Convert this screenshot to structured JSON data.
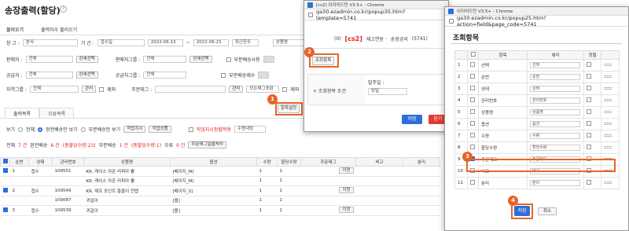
{
  "page": {
    "title": "송장출력(할당)"
  },
  "subtabs": [
    "불러오기",
    "출력자수 불러오기"
  ],
  "filters": {
    "warehouse_label": "창 고 :",
    "warehouse_value": "본사",
    "period_label": "기 간 :",
    "period_type": "접수일",
    "date_from": "2022-06-15",
    "date_to": "2022-06-21",
    "period_preset": "최근한주",
    "product_type": "상품명",
    "vendor_label": "판매처 :",
    "vendor_value": "전체",
    "vendor_btn": "상세선택",
    "vendor_group_label": "판매처그룹 :",
    "vendor_group_value": "전체",
    "vendor_group_btn": "상세선택",
    "partial_label": "부분배송사용",
    "supplier_label": "공급처 :",
    "supplier_value": "전체",
    "supplier_btn": "상세선택",
    "supplier_group_label": "공급처그룹 :",
    "supplier_group_value": "전체",
    "partial_supplier_label": "부분배송제수",
    "region_label": "지역그룹 :",
    "region_value": "전체",
    "region_manage": "관리",
    "exclude1": "제외",
    "order_tag_label": "주문태그 :",
    "order_tag_manage": "관리",
    "order_tag_all": "모든태그포함",
    "exclude2": "제외",
    "column_setting_btn": "항목설정"
  },
  "tabs2": [
    "출력목록",
    "오류목록"
  ],
  "view_options": {
    "view_label": "보기",
    "all": "전체",
    "complete": "완전배송만 보기",
    "partial": "부분배송만 보기",
    "btn_a": "작업지시",
    "btn_b": "작업상품",
    "warn_label": "작업지시정렬적용",
    "sort_value": "수령내림"
  },
  "summary": {
    "total_label": "전체",
    "total": "7 건",
    "complete_label": "완전배송",
    "complete": "6 건",
    "complete_detail": "(총할당수량:23)",
    "partial_label": "부분배송",
    "partial": "1 건",
    "partial_detail": "(총할당수량:1)",
    "error_label": "오류",
    "error": "0 건",
    "export_btn": "주문태그일괄처리"
  },
  "grid": {
    "headers": [
      "",
      "순번",
      "상태",
      "관리번호",
      "상품명",
      "옵션",
      "수량",
      "할당수량",
      "주문태그",
      "비고",
      "분리"
    ],
    "rows": [
      {
        "check": true,
        "seq": "1",
        "status": "접수",
        "id": "109551",
        "name": "KR. 캐이스 자존 리피아 뿅",
        "option": "[베이지_M]",
        "qty": "1",
        "alloc": "1",
        "tag_btn": "지정"
      },
      {
        "check": false,
        "seq": "",
        "status": "",
        "id": "",
        "name": "KR. 캐이스 자존 리피아 뿅",
        "option": "[베이지_M]",
        "qty": "1",
        "alloc": "1",
        "tag_btn": ""
      },
      {
        "check": true,
        "seq": "2",
        "status": "접수",
        "id": "109549",
        "name": "KR. 제프 포인트 들들이 전랩",
        "option": "[베이지_S]",
        "qty": "1",
        "alloc": "1",
        "tag_btn": "지정"
      },
      {
        "check": false,
        "seq": "",
        "status": "",
        "id": "109087",
        "name": "귀걸이",
        "option": "[블]",
        "qty": "1",
        "alloc": "1",
        "tag_btn": ""
      },
      {
        "check": true,
        "seq": "3",
        "status": "접수",
        "id": "109539",
        "name": "귀걸이",
        "option": "[블]",
        "qty": "1",
        "alloc": "1",
        "tag_btn": "지정"
      }
    ]
  },
  "popup1": {
    "chrome_title": "[cs2] 이지어드민 V3.5+ - Chrome",
    "url": "ga30.ezadmin.co.kr/popup35.htm?template=5741",
    "header_prefix": "(0)",
    "header_code": "[cs2]",
    "header_mid": "재고연동 ·",
    "header_type": "송장공리",
    "header_id": "(5741)",
    "tab_label": "조회항목",
    "condition_label": "+ 조회항목 조건",
    "issue_label": "발주일 :",
    "issue_value": "당일",
    "save_btn": "저장",
    "close_btn": "닫기"
  },
  "popup2": {
    "chrome_title": "이지어드민 V3.5+ - Chrome",
    "url": "ga30.ezadmin.co.kr/popup25.htm?action=field&page_code=5741",
    "title": "조회항목",
    "headers": [
      "",
      "",
      "항목",
      "헤더",
      "정렬",
      ""
    ],
    "rows": [
      {
        "no": "1",
        "check": false,
        "item": "선택",
        "header": "선택"
      },
      {
        "no": "2",
        "check": false,
        "item": "순번",
        "header": "순번"
      },
      {
        "no": "3",
        "check": false,
        "item": "상태",
        "header": "상태"
      },
      {
        "no": "4",
        "check": false,
        "item": "관리번호",
        "header": "관리번호"
      },
      {
        "no": "5",
        "check": false,
        "item": "상품명",
        "header": "상품명"
      },
      {
        "no": "6",
        "check": false,
        "item": "옵션",
        "header": "옵션"
      },
      {
        "no": "7",
        "check": false,
        "item": "수량",
        "header": "수량"
      },
      {
        "no": "8",
        "check": false,
        "item": "할당수량",
        "header": "할당수량"
      },
      {
        "no": "9",
        "check": true,
        "item": "주문태그",
        "header": "주문태그"
      },
      {
        "no": "10",
        "check": false,
        "item": "비고",
        "header": "비고"
      },
      {
        "no": "11",
        "check": false,
        "item": "분리",
        "header": "분리"
      }
    ],
    "save_btn": "저장",
    "cancel_btn": "취소"
  },
  "badges": [
    "1",
    "2",
    "3",
    "4"
  ],
  "colors": {
    "accent": "#2d6fd8",
    "highlight": "#e8632a",
    "danger": "#e53935"
  }
}
